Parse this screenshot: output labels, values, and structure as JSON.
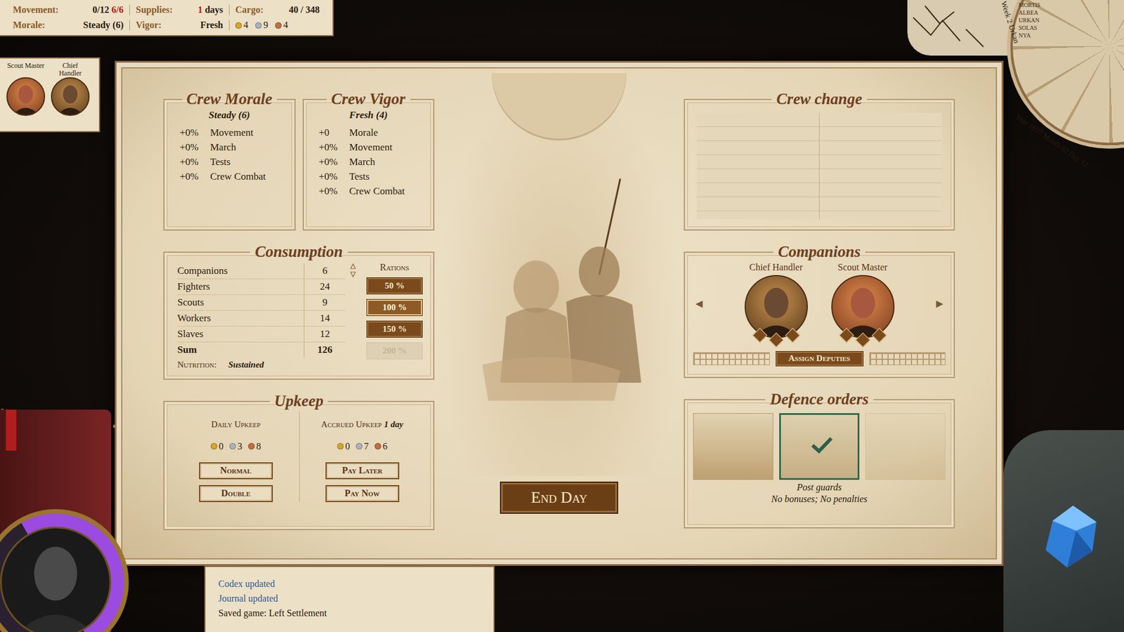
{
  "status": {
    "movement": {
      "label": "Movement:",
      "value": "0/12",
      "extra": "6/6"
    },
    "supplies": {
      "label": "Supplies:",
      "value": "1",
      "unit": "days"
    },
    "cargo": {
      "label": "Cargo:",
      "value": "40 / 348"
    },
    "morale": {
      "label": "Morale:",
      "value": "Steady (6)"
    },
    "vigor": {
      "label": "Vigor:",
      "value": "Fresh"
    },
    "coins": [
      {
        "amount": "4",
        "color": "#d8a42a"
      },
      {
        "amount": "9",
        "color": "#a9b3bd"
      },
      {
        "amount": "4",
        "color": "#c0703f"
      }
    ]
  },
  "party": [
    {
      "label": "Scout Master"
    },
    {
      "label": "Chief Handler"
    }
  ],
  "calendar": {
    "week": "Week 2 Urkan",
    "date": "Year 1097 Month 02 Day 12",
    "months": [
      "MORTIS",
      "ALBEA",
      "URKAN",
      "SOLAS",
      "NYA"
    ]
  },
  "morale_panel": {
    "title": "Crew Morale",
    "state": "Steady (6)",
    "rows": [
      {
        "value": "+0%",
        "label": "Movement"
      },
      {
        "value": "+0%",
        "label": "March"
      },
      {
        "value": "+0%",
        "label": "Tests"
      },
      {
        "value": "+0%",
        "label": "Crew Combat"
      }
    ]
  },
  "vigor_panel": {
    "title": "Crew Vigor",
    "state": "Fresh (4)",
    "rows": [
      {
        "value": "+0",
        "label": "Morale"
      },
      {
        "value": "+0%",
        "label": "Movement"
      },
      {
        "value": "+0%",
        "label": "March"
      },
      {
        "value": "+0%",
        "label": "Tests"
      },
      {
        "value": "+0%",
        "label": "Crew Combat"
      }
    ]
  },
  "consumption": {
    "title": "Consumption",
    "rows": [
      {
        "label": "Companions",
        "value": "6"
      },
      {
        "label": "Fighters",
        "value": "24"
      },
      {
        "label": "Scouts",
        "value": "9"
      },
      {
        "label": "Workers",
        "value": "14"
      },
      {
        "label": "Slaves",
        "value": "12"
      }
    ],
    "sum": {
      "label": "Sum",
      "value": "126"
    },
    "nutrition": {
      "label": "Nutrition:",
      "value": "Sustained"
    }
  },
  "rations": {
    "title": "Rations",
    "options": [
      {
        "label": "50 %",
        "selected": false,
        "disabled": false
      },
      {
        "label": "100 %",
        "selected": true,
        "disabled": false
      },
      {
        "label": "150 %",
        "selected": false,
        "disabled": false
      },
      {
        "label": "200 %",
        "selected": false,
        "disabled": true
      }
    ]
  },
  "upkeep": {
    "title": "Upkeep",
    "daily": {
      "label": "Daily Upkeep",
      "coins": [
        {
          "amount": "0",
          "color": "#d8a42a"
        },
        {
          "amount": "3",
          "color": "#a9b3bd"
        },
        {
          "amount": "8",
          "color": "#c0703f"
        }
      ],
      "buttons": [
        "Normal",
        "Double"
      ]
    },
    "accrued": {
      "label": "Accrued Upkeep",
      "days": "1 day",
      "coins": [
        {
          "amount": "0",
          "color": "#d8a42a"
        },
        {
          "amount": "7",
          "color": "#a9b3bd"
        },
        {
          "amount": "6",
          "color": "#c0703f"
        }
      ],
      "buttons": [
        "Pay Later",
        "Pay Now"
      ]
    }
  },
  "end_day": "End Day",
  "crew_change": {
    "title": "Crew change",
    "entries": []
  },
  "companions": {
    "title": "Companions",
    "prev": "◀",
    "next": "▶",
    "members": [
      {
        "name": "Chief Handler"
      },
      {
        "name": "Scout Master"
      }
    ],
    "button": "Assign Deputies"
  },
  "defence": {
    "title": "Defence orders",
    "orders": [
      {
        "selected": false,
        "disabled": false
      },
      {
        "selected": true,
        "disabled": false
      },
      {
        "selected": false,
        "disabled": true
      }
    ],
    "caption": "Post guards",
    "effect": "No bonuses; No penalties"
  },
  "log": [
    {
      "text": "Codex updated",
      "kind": "link"
    },
    {
      "text": "Journal updated",
      "kind": "link"
    },
    {
      "text": "Saved game: Left Settlement",
      "kind": "plain"
    }
  ],
  "hero": {
    "level": 0.5
  }
}
